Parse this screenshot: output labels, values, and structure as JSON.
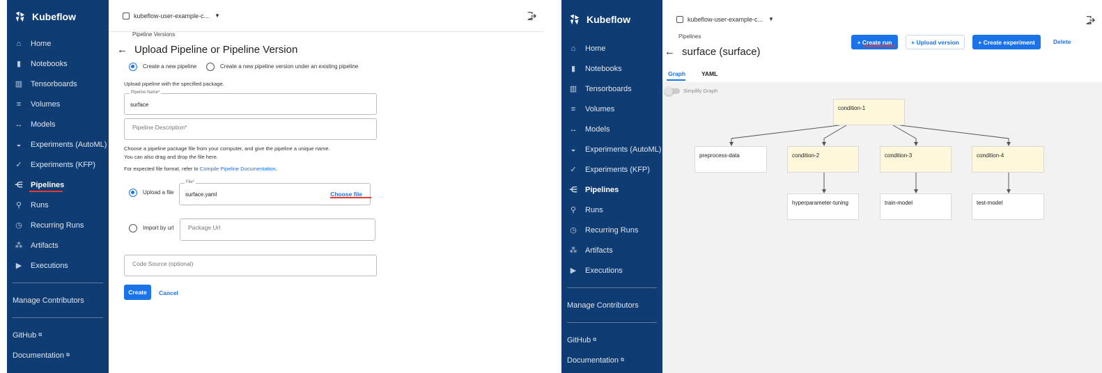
{
  "colors": {
    "sidebar_bg": "#0f3d73",
    "accent": "#1a73e8",
    "annotation": "#e53935",
    "condition_node": "#fff8da"
  },
  "left": {
    "brand": "Kubeflow",
    "namespace": "kubeflow-user-example-c...",
    "nav": [
      {
        "label": "Home",
        "icon": "home-icon"
      },
      {
        "label": "Notebooks",
        "icon": "notebook-icon"
      },
      {
        "label": "Tensorboards",
        "icon": "chart-icon"
      },
      {
        "label": "Volumes",
        "icon": "list-icon"
      },
      {
        "label": "Models",
        "icon": "arrows-icon"
      },
      {
        "label": "Experiments (AutoML)",
        "icon": "automl-icon"
      },
      {
        "label": "Experiments (KFP)",
        "icon": "check-icon"
      },
      {
        "label": "Pipelines",
        "icon": "pipeline-icon"
      },
      {
        "label": "Runs",
        "icon": "runner-icon"
      },
      {
        "label": "Recurring Runs",
        "icon": "alarm-icon"
      },
      {
        "label": "Artifacts",
        "icon": "artifact-icon"
      },
      {
        "label": "Executions",
        "icon": "play-icon"
      }
    ],
    "manage_contributors": "Manage Contributors",
    "github": "GitHub",
    "documentation": "Documentation",
    "breadcrumb": "Pipeline Versions",
    "page_title": "Upload Pipeline or Pipeline Version",
    "radio_new": "Create a new pipeline",
    "radio_version": "Create a new pipeline version under an existing pipeline",
    "upload_hint": "Upload pipeline with the specified package.",
    "pipeline_name_label": "Pipeline Name*",
    "pipeline_name_value": "surface",
    "pipeline_desc_placeholder": "Pipeline Description*",
    "help_line1": "Choose a pipeline package file from your computer, and give the pipeline a unique name.",
    "help_line2": "You can also drag and drop the file here.",
    "help_line3_prefix": "For expected file format, refer to ",
    "help_link": "Compile Pipeline Documentation",
    "help_line3_suffix": ".",
    "upload_file_label": "Upload a file",
    "file_label": "File*",
    "file_value": "surface.yaml",
    "choose_file": "Choose file",
    "import_url_label": "Import by url",
    "package_url_placeholder": "Package Url",
    "code_source_placeholder": "Code Source (optional)",
    "create": "Create",
    "cancel": "Cancel"
  },
  "right": {
    "brand": "Kubeflow",
    "namespace": "kubeflow-user-example-c...",
    "breadcrumb": "Pipelines",
    "page_title": "surface (surface)",
    "create_run": "Create run",
    "upload_version": "Upload version",
    "create_experiment": "Create experiment",
    "delete": "Delete",
    "tab_graph": "Graph",
    "tab_yaml": "YAML",
    "simplify_graph": "Simplify Graph",
    "nodes": {
      "condition_1": "condition-1",
      "preprocess": "preprocess-data",
      "condition_2": "condition-2",
      "condition_3": "condition-3",
      "condition_4": "condition-4",
      "hyperparameter": "hyperparameter-tuning",
      "train": "train-model",
      "test": "test-model"
    }
  }
}
